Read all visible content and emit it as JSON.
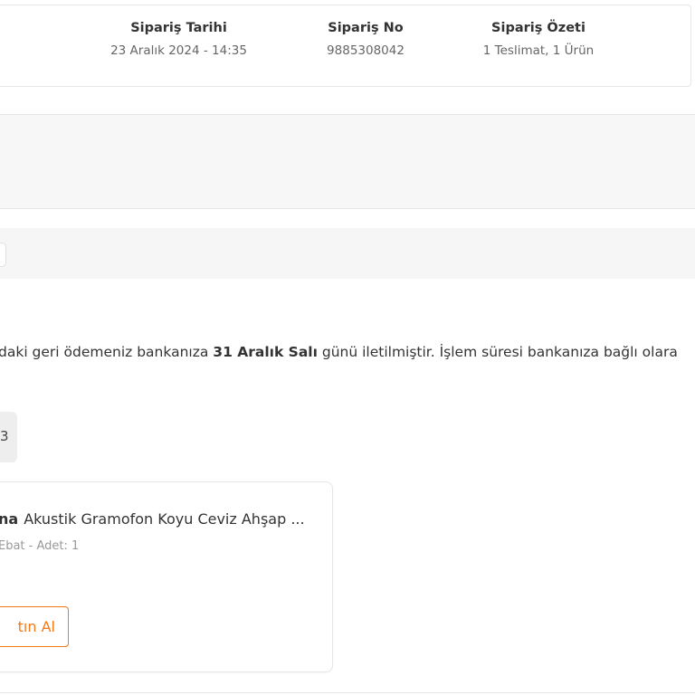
{
  "order_summary": {
    "date": {
      "label": "Sipariş Tarihi",
      "value": "23 Aralık 2024 - 14:35"
    },
    "number": {
      "label": "Sipariş No",
      "value": "9885308042"
    },
    "summary": {
      "label": "Sipariş Özeti",
      "value": "1 Teslimat, 1 Ürün"
    }
  },
  "refund_notice": {
    "prefix": "daki geri ödemeniz bankanıza ",
    "date_bold": "31 Aralık Salı",
    "suffix": " günü iletilmiştir. İşlem süresi bankanıza bağlı olara"
  },
  "quantity_badge": "3",
  "product": {
    "brand": "na",
    "name": "Akustik Gramofon Koyu Ceviz Ahşap ...",
    "meta": "Ebat - Adet: 1",
    "buy_label": "tın Al"
  },
  "colors": {
    "accent": "#f27a1a",
    "border": "#e6e6e6",
    "panel": "#f7f7f7"
  }
}
